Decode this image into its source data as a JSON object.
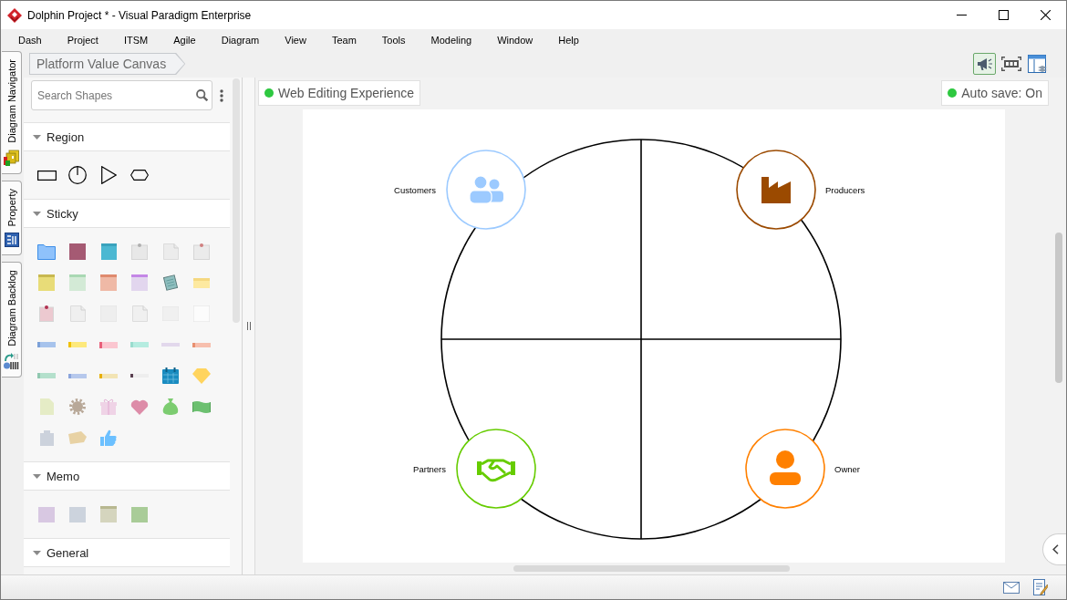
{
  "window": {
    "title": "Dolphin Project * - Visual Paradigm Enterprise"
  },
  "menu": [
    "Dash",
    "Project",
    "ITSM",
    "Agile",
    "Diagram",
    "View",
    "Team",
    "Tools",
    "Modeling",
    "Window",
    "Help"
  ],
  "side_tabs": [
    {
      "label": "Diagram Navigator"
    },
    {
      "label": "Property"
    },
    {
      "label": "Diagram Backlog"
    }
  ],
  "breadcrumb": "Platform Value Canvas",
  "toolbar": [
    {
      "on": true
    },
    {
      "on": false
    },
    {
      "on": false
    }
  ],
  "palette": {
    "search": {
      "placeholder": "Search Shapes"
    },
    "sections": [
      {
        "title": "Region",
        "kind": "region",
        "expanded": true
      },
      {
        "title": "Sticky",
        "kind": "sticky",
        "expanded": true
      },
      {
        "title": "Memo",
        "kind": "memo",
        "expanded": true
      },
      {
        "title": "General",
        "kind": "general",
        "expanded": true
      }
    ]
  },
  "diagram": {
    "mode_badge": "Web Editing Experience",
    "autosave": "Auto save: On",
    "nodes": [
      {
        "label": "Customers",
        "color": "#9ccaff"
      },
      {
        "label": "Producers",
        "color": "#9b4a00"
      },
      {
        "label": "Partners",
        "color": "#66cc00"
      },
      {
        "label": "Owner",
        "color": "#ff8000"
      }
    ]
  }
}
